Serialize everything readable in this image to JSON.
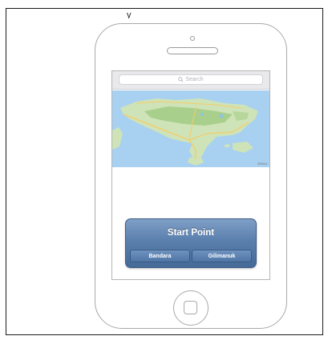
{
  "header": {
    "partial_text": "y"
  },
  "search": {
    "placeholder": "Search"
  },
  "map": {
    "credit": "©2014",
    "colors": {
      "water": "#a8d0f0",
      "land": "#cfe3b8",
      "forest": "#a9cf8c",
      "road": "#f4cc6a"
    }
  },
  "control": {
    "title": "Start Point",
    "options": [
      "Bandara",
      "Gilimanuk"
    ],
    "accent": "#5a7fad"
  }
}
